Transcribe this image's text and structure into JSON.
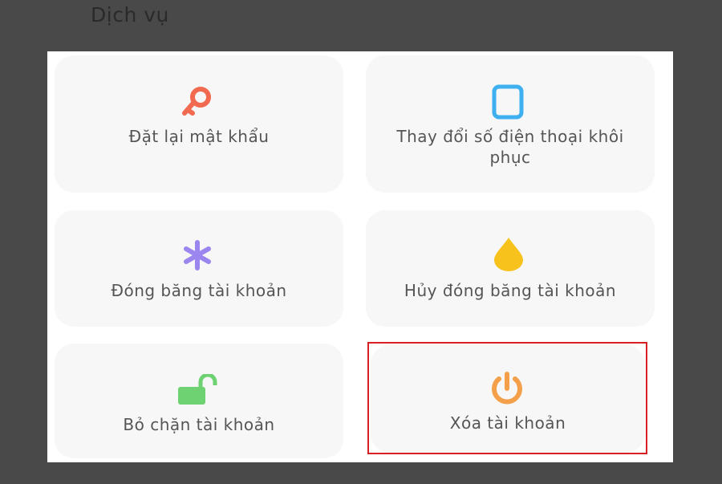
{
  "section": {
    "title": "Dịch vụ"
  },
  "services": [
    {
      "id": "reset-password",
      "label": "Đặt lại mật khẩu",
      "icon": "key-icon",
      "color": "#f26a4f"
    },
    {
      "id": "change-phone",
      "label": "Thay đổi số điện thoại khôi phục",
      "icon": "phone-icon",
      "color": "#3fb0ef"
    },
    {
      "id": "freeze-account",
      "label": "Đóng băng tài khoản",
      "icon": "asterisk-icon",
      "color": "#9b86f0"
    },
    {
      "id": "unfreeze-account",
      "label": "Hủy đóng băng tài khoản",
      "icon": "drop-icon",
      "color": "#f7c21b"
    },
    {
      "id": "unlock-account",
      "label": "Bỏ chặn tài khoản",
      "icon": "unlock-icon",
      "color": "#6ed273"
    },
    {
      "id": "delete-account",
      "label": "Xóa tài khoản",
      "icon": "power-icon",
      "color": "#f4a04a"
    }
  ],
  "highlight": {
    "color": "#d91f26",
    "target": "delete-account"
  }
}
